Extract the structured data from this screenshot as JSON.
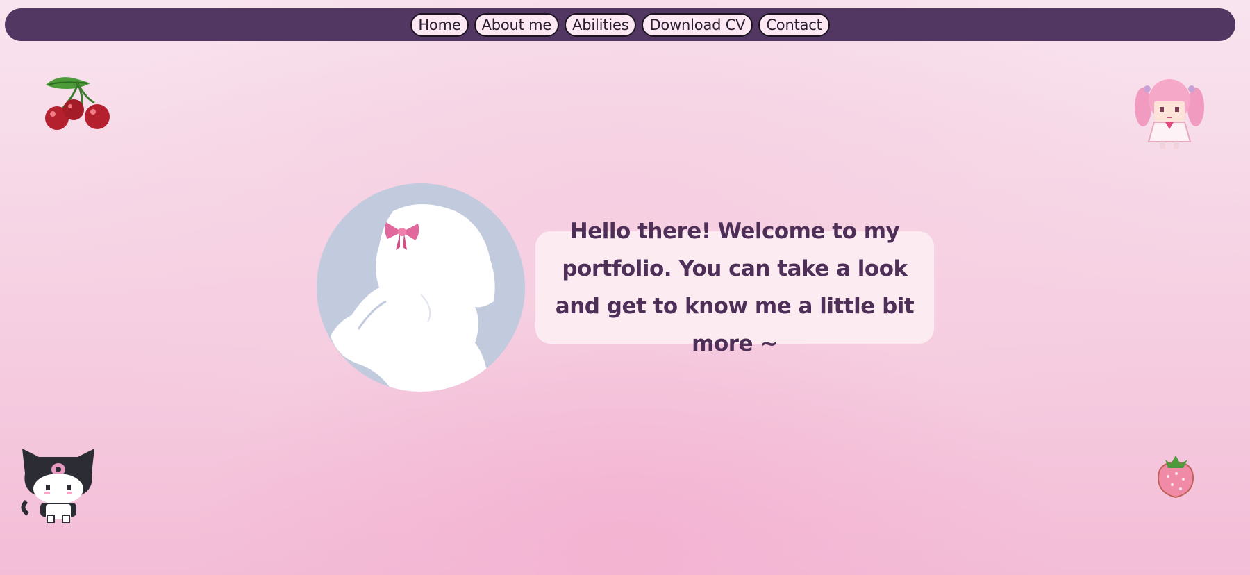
{
  "nav": {
    "items": [
      {
        "label": "Home"
      },
      {
        "label": "About me"
      },
      {
        "label": "Abilities"
      },
      {
        "label": "Download CV"
      },
      {
        "label": "Contact"
      }
    ]
  },
  "hero": {
    "welcome_text": "Hello there! Welcome to my portfolio. You can take a look and get to know me a little bit more ~"
  },
  "decorations": {
    "top_left": "cherries-icon",
    "top_right": "pink-haired-girl-icon",
    "bottom_left": "kuromi-icon",
    "bottom_right": "strawberry-icon"
  },
  "colors": {
    "navbar": "#533763",
    "button_bg": "#fbe8f2",
    "text_accent": "#4d2f58",
    "avatar_bg": "#c2cadd",
    "bow": "#e0689c"
  }
}
